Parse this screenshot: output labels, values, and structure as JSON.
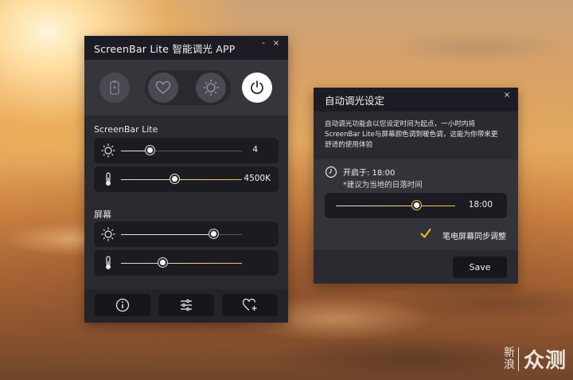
{
  "main_window": {
    "title": "ScreenBar Lite 智能调光 APP",
    "minimize_label": "-",
    "close_label": "×",
    "modes": [
      "battery-icon",
      "heart-icon",
      "auto-light-icon",
      "power-icon"
    ],
    "section_lamp": "ScreenBar Lite",
    "lamp_brightness": {
      "value_label": "4",
      "level": 0.24
    },
    "lamp_temperature": {
      "value_label": "4500K",
      "level": 0.44
    },
    "section_screen": "屏幕",
    "screen_brightness": {
      "level": 0.76
    },
    "screen_temperature": {
      "level": 0.34
    },
    "bottom_buttons": [
      "info-icon",
      "adjust-icon",
      "add-favorite-icon"
    ]
  },
  "dialog": {
    "title": "自动调光设定",
    "close_label": "×",
    "description_lines": [
      "自动调光功能会以您设定时间为起点，一小时内将",
      "ScreenBar Lite与屏幕颜色调到暖色调，这能为你带来更",
      "舒适的使用体验"
    ],
    "start_label": "开启于: 18:00",
    "hint": "*建议为当地的日落时间",
    "time_value": "18:00",
    "time_level": 0.67,
    "sync_label": "笔电屏幕同步调整",
    "sync_checked": true,
    "save_label": "Save"
  },
  "watermark": {
    "text_left_top": "新",
    "text_left_bottom": "浪",
    "text_right": "众测"
  },
  "colors": {
    "accent_yellow": "#f2c321",
    "warm_track": "#e8c34a",
    "cool_track": "#cfe3f2"
  }
}
